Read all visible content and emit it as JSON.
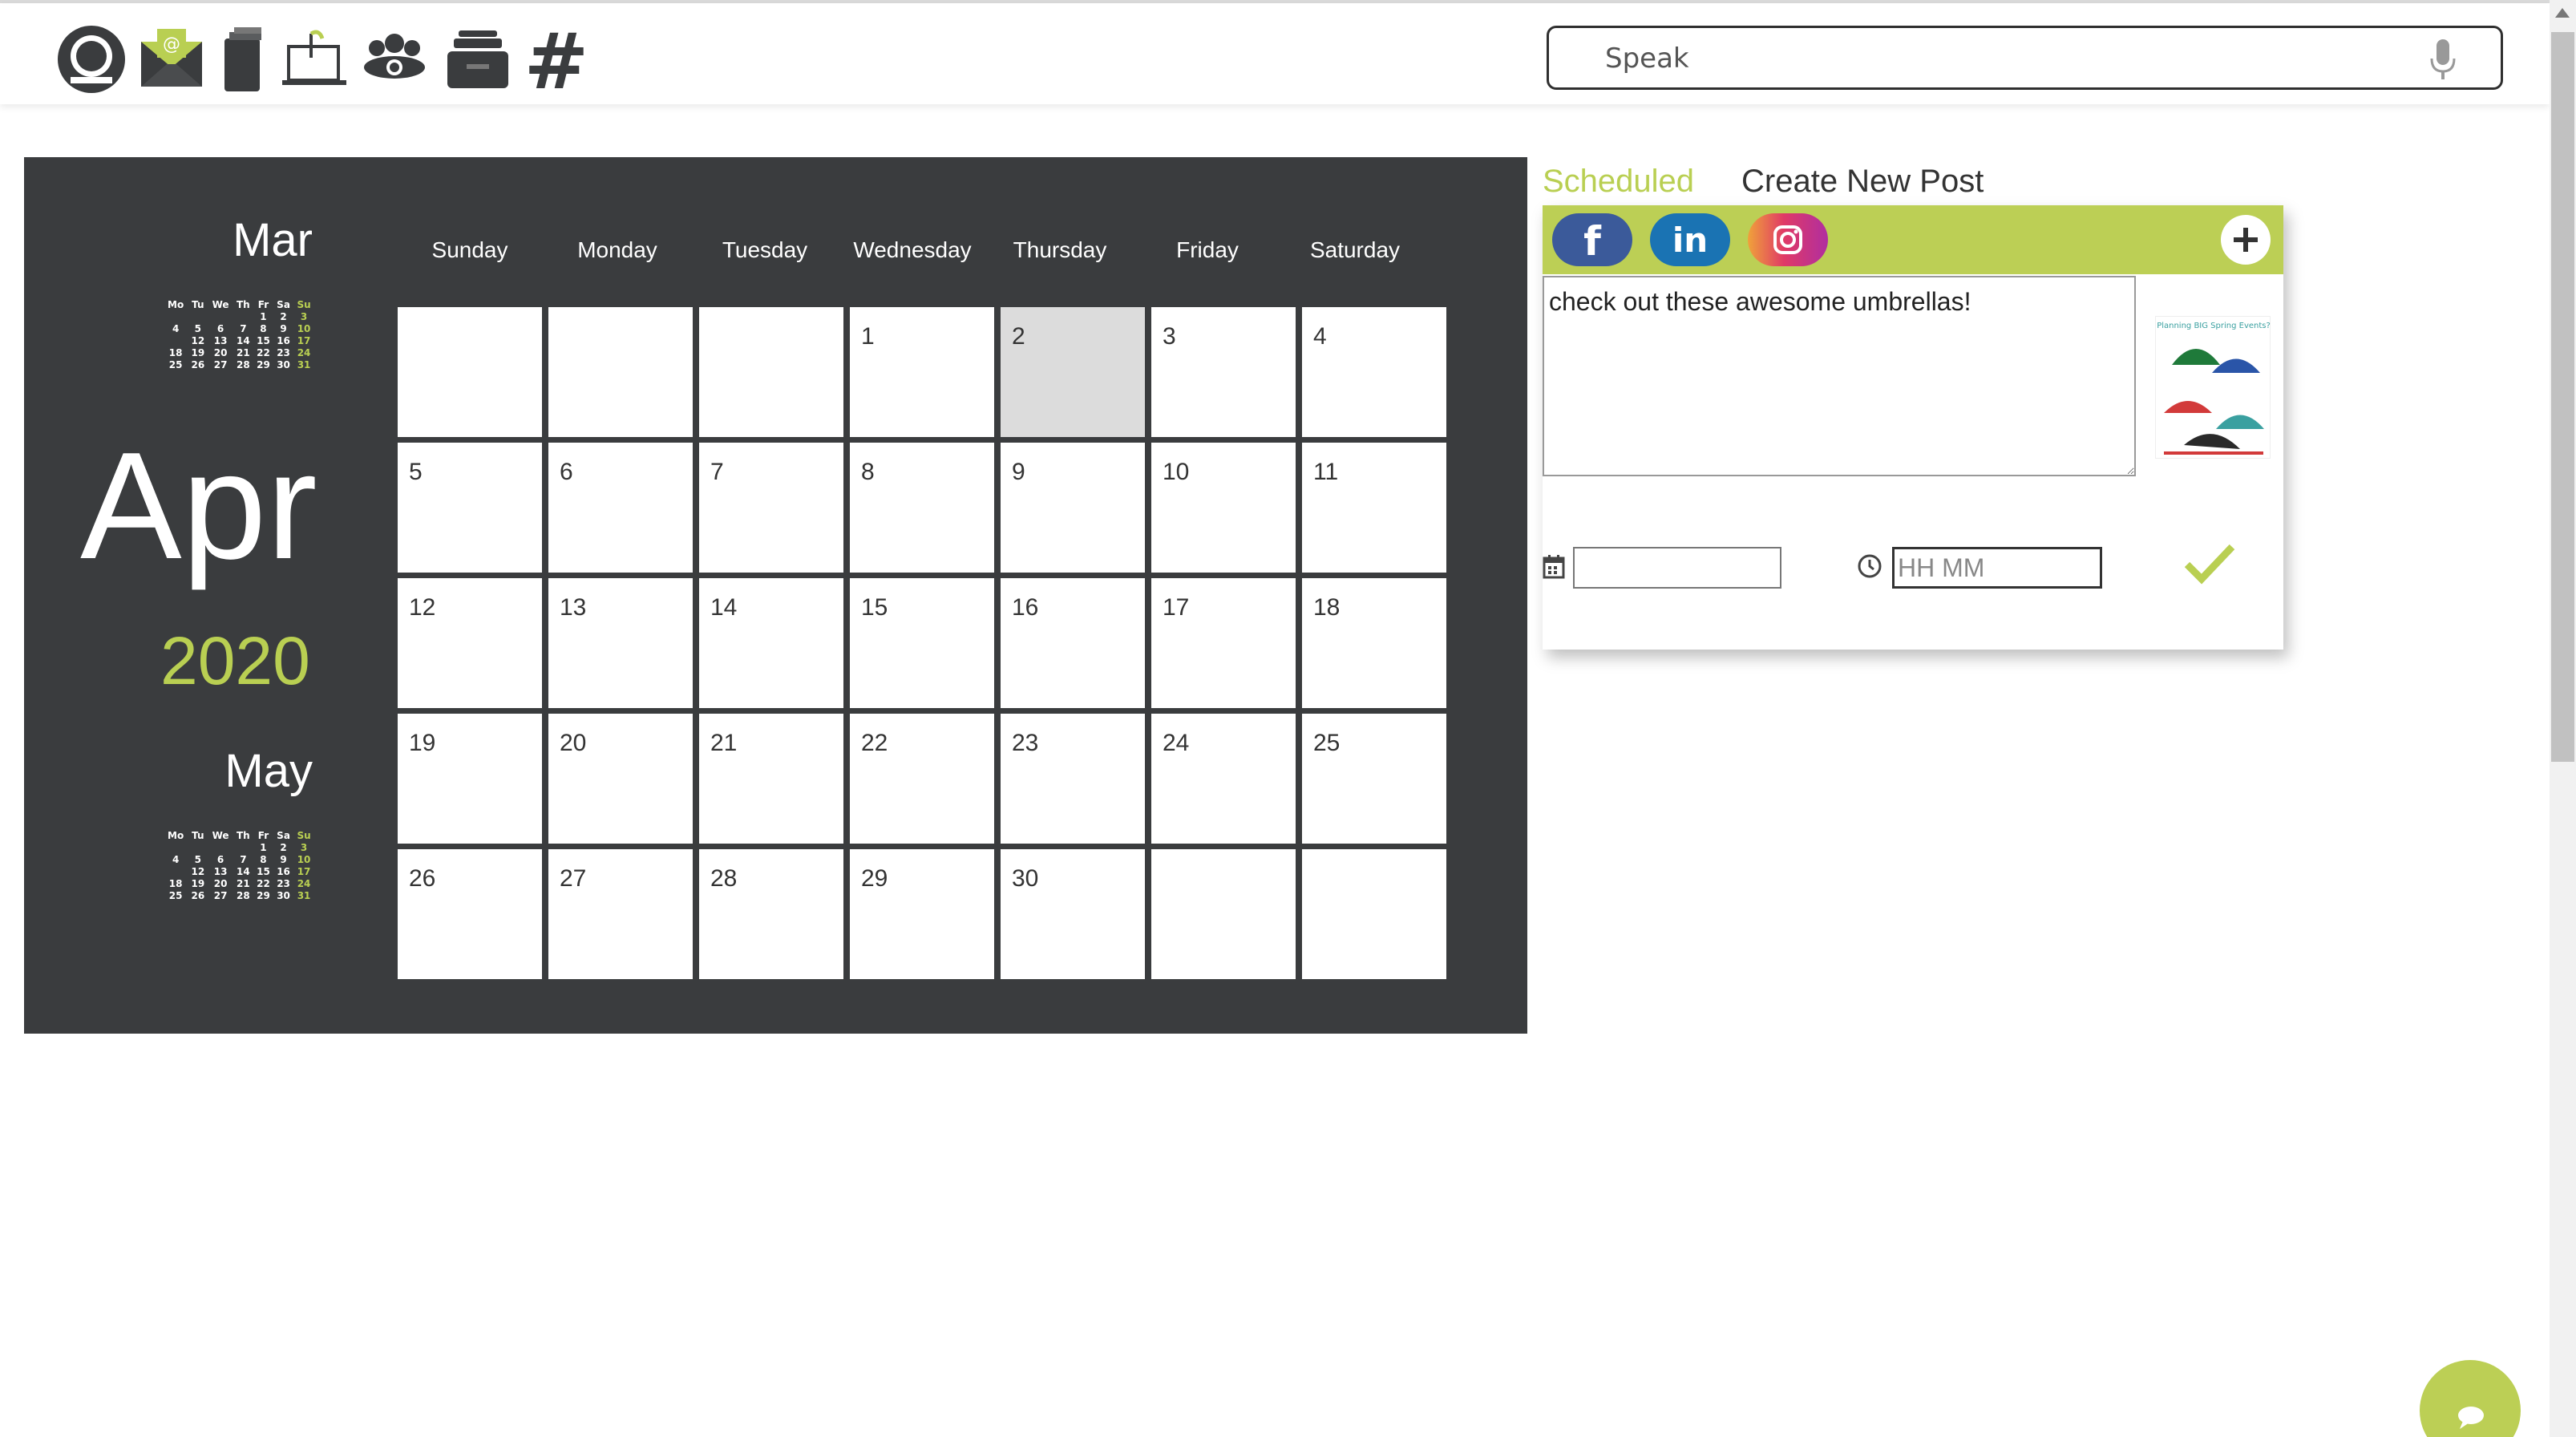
{
  "toolbar": {
    "icons": [
      "user-profile-icon",
      "email-icon",
      "documents-icon",
      "laptop-icon",
      "group-icon",
      "inbox-icon",
      "hashtag-icon"
    ],
    "hashtag_symbol": "#"
  },
  "search": {
    "placeholder": "Speak",
    "value": ""
  },
  "calendar": {
    "prev_month": "Mar",
    "current_month": "Apr",
    "year": "2020",
    "next_month": "May",
    "weekdays": [
      "Sunday",
      "Monday",
      "Tuesday",
      "Wednesday",
      "Thursday",
      "Friday",
      "Saturday"
    ],
    "days": [
      "",
      "",
      "",
      "1",
      "2",
      "3",
      "4",
      "5",
      "6",
      "7",
      "8",
      "9",
      "10",
      "11",
      "12",
      "13",
      "14",
      "15",
      "16",
      "17",
      "18",
      "19",
      "20",
      "21",
      "22",
      "23",
      "24",
      "25",
      "26",
      "27",
      "28",
      "29",
      "30",
      "",
      ""
    ],
    "today": "2",
    "mini_headers": [
      "Mo",
      "Tu",
      "We",
      "Th",
      "Fr",
      "Sa",
      "Su"
    ],
    "mini_rows": [
      [
        "",
        "",
        "",
        "",
        "1",
        "2",
        "3"
      ],
      [
        "4",
        "5",
        "6",
        "7",
        "8",
        "9",
        "10"
      ],
      [
        "",
        "12",
        "13",
        "14",
        "15",
        "16",
        "17"
      ],
      [
        "18",
        "19",
        "20",
        "21",
        "22",
        "23",
        "24"
      ],
      [
        "25",
        "26",
        "27",
        "28",
        "29",
        "30",
        "31"
      ]
    ]
  },
  "tabs": {
    "scheduled": "Scheduled",
    "create": "Create New Post"
  },
  "post": {
    "text": "check out these awesome umbrellas!",
    "date_value": "",
    "time_placeholder": "HH MM",
    "thumbnail_caption": "Planning BIG Spring Events?"
  },
  "colors": {
    "accent": "#bccf55",
    "panel": "#3a3c3e",
    "facebook": "#3b5a9a",
    "linkedin": "#1a73b3"
  }
}
